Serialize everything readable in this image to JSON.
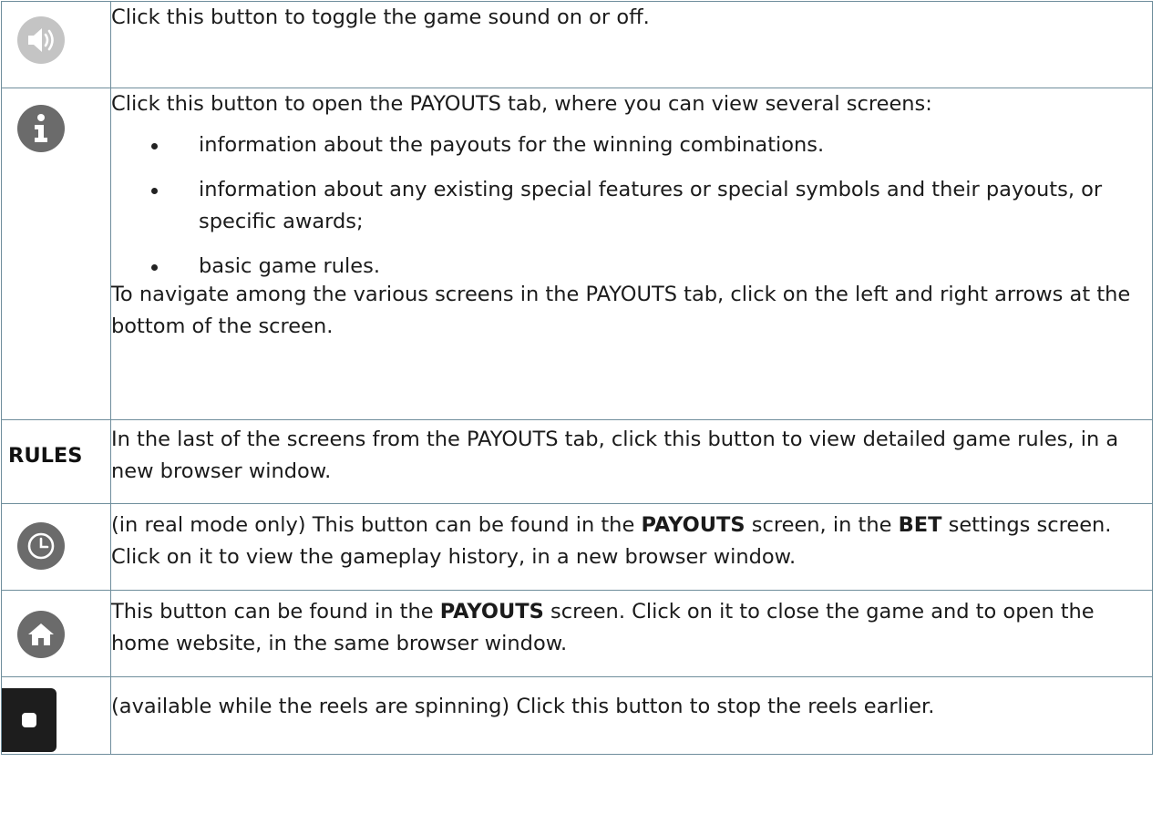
{
  "rows": [
    {
      "icon": "speaker-icon",
      "text": "Click this button to toggle the game sound on or off."
    },
    {
      "icon": "info-icon",
      "intro": "Click this button to open the PAYOUTS tab, where you can view several screens:",
      "bullets": [
        "information about the payouts for the winning combinations.",
        "information about any existing special features or special symbols and their payouts, or specific awards;",
        "basic game rules."
      ],
      "outro": "To navigate among the various screens in the PAYOUTS tab, click on the left and right arrows at the bottom of the screen."
    },
    {
      "label": "RULES",
      "text": "In the last of the screens from the PAYOUTS tab, click this button to view detailed game rules, in a new browser window."
    },
    {
      "icon": "clock-icon",
      "part1": "(in real mode only) This button can be found in the ",
      "bold1": "PAYOUTS",
      "part2": " screen, in the ",
      "bold2": "BET",
      "part3": " settings screen. Click on it to view the gameplay history, in a new browser window."
    },
    {
      "icon": "home-icon",
      "part1": "This button can be found in the ",
      "bold1": "PAYOUTS",
      "part2": " screen. Click on it to close the game and to open the home website, in the same browser window."
    },
    {
      "icon": "stop-icon",
      "text": "(available while the reels are spinning) Click this button to stop the reels earlier."
    }
  ],
  "colors": {
    "border": "#6f8e9c",
    "speaker_bg": "#c4c4c4",
    "icon_dark_bg": "#6b6b6b",
    "stop_bg": "#1d1d1d"
  }
}
